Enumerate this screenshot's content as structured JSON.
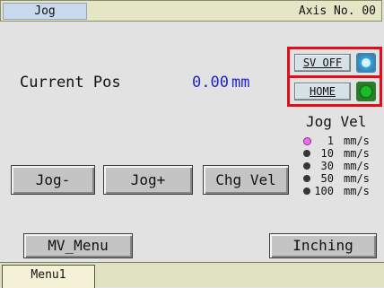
{
  "header": {
    "active_tab": "Jog",
    "axis_label": "Axis No. 00"
  },
  "position": {
    "label": "Current Pos",
    "value": "0.00",
    "unit": "mm"
  },
  "servo": {
    "button_label": "SV OFF",
    "lamp_color": "#2f9fe0"
  },
  "home": {
    "button_label": "HOME",
    "lamp_color": "#1dbb28"
  },
  "jog_velocity": {
    "title": "Jog Vel",
    "options": [
      {
        "value": "1",
        "unit": "mm/s",
        "selected": true
      },
      {
        "value": "10",
        "unit": "mm/s",
        "selected": false
      },
      {
        "value": "30",
        "unit": "mm/s",
        "selected": false
      },
      {
        "value": "50",
        "unit": "mm/s",
        "selected": false
      },
      {
        "value": "100",
        "unit": "mm/s",
        "selected": false
      }
    ]
  },
  "buttons": {
    "jog_minus": "Jog-",
    "jog_plus": "Jog+",
    "chg_vel": "Chg Vel",
    "mv_menu": "MV_Menu",
    "inching": "Inching"
  },
  "footer": {
    "menu_tab": "Menu1"
  }
}
